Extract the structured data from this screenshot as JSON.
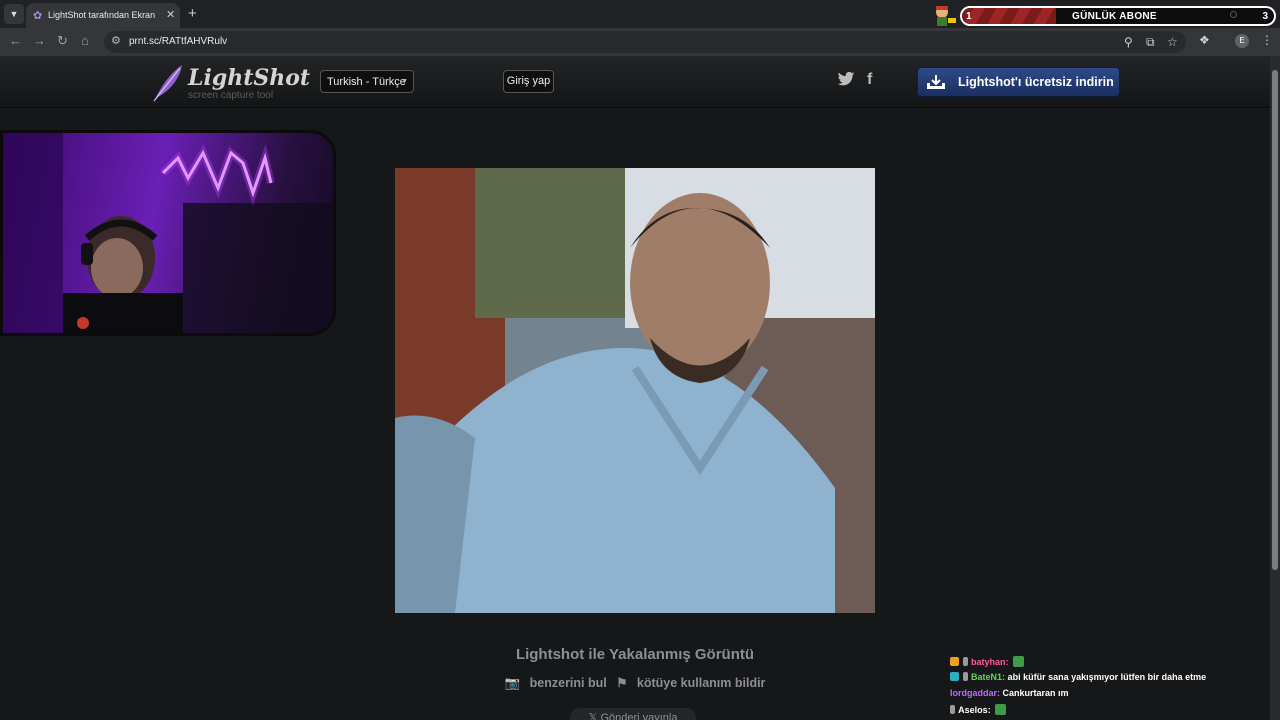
{
  "browser": {
    "tab_title": "LightShot tarafından Ekran Görüntüsü",
    "tab_favicon": "feather-icon",
    "new_tab": "+",
    "url": "prnt.sc/RATtfAHVRulv",
    "profile_initial": "E"
  },
  "subgoal": {
    "current": "1",
    "label": "GÜNLÜK ABONE",
    "target": "3",
    "progress": 0.3
  },
  "header": {
    "logo_text": "LightShot",
    "logo_subtitle": "screen capture tool",
    "language": "Turkish - Türkçe",
    "login": "Giriş yap",
    "twitter": "twitter-icon",
    "facebook": "f",
    "download": "Lightshot'ı ücretsiz indirin"
  },
  "content": {
    "caption": "Lightshot ile Yakalanmış Görüntü",
    "find_similar": "benzerini bul",
    "report": "kötüye kullanım bildir",
    "tweet": "Gönderi yayınla"
  },
  "chat": [
    {
      "user": "batyhan",
      "color": "#ff5a9a",
      "text": ""
    },
    {
      "user": "BateN1",
      "color": "#63d45a",
      "text": "abi küfür sana yakışmıyor lütfen bir daha etme"
    },
    {
      "user": "lordgaddar",
      "color": "#b86bff",
      "text": "Cankurtaran ım"
    },
    {
      "user": "Aselos",
      "color": "#f0f0f0",
      "text": ""
    }
  ],
  "colors": {
    "page_bg": "#161718",
    "download_btn": "#2e4a8a",
    "accent_purple": "#6a1fb5"
  }
}
